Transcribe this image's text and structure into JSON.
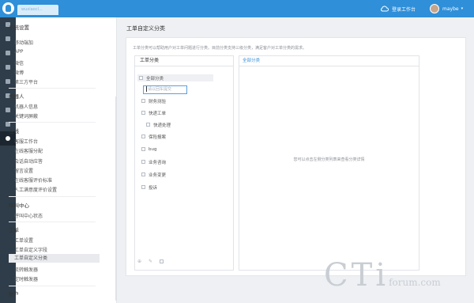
{
  "topbar": {
    "tab_label": "wuxiaocl...",
    "workbench_label": "登录工作台",
    "user_name": "maybe"
  },
  "rail_icons": [
    "home-icon",
    "chat-icon",
    "ticket-icon",
    "document-icon",
    "user-icon",
    "group-icon",
    "stats-icon",
    "search-icon",
    "settings-icon"
  ],
  "sidebar": {
    "sections": [
      {
        "title": "系统设置",
        "items": [
          "移动端加",
          "APP",
          "微信",
          "微博",
          "第三方平台"
        ]
      },
      {
        "title": "机器人",
        "items": [
          "机器人信息",
          "关键词屏蔽"
        ]
      },
      {
        "title": "在线",
        "items": [
          "客服工作台",
          "在线客服分配",
          "会话自动应答",
          "留言设置",
          "在线客服评价标准",
          "人工满意度评价设置"
        ]
      },
      {
        "title": "呼叫中心",
        "items": [
          "呼叫中心状态"
        ]
      },
      {
        "title": "工单",
        "items": [
          "工单设置",
          "工单自定义字段",
          "工单自定义分类",
          "流转触发器",
          "定时触发器"
        ]
      },
      {
        "title": "账户",
        "items": []
      }
    ]
  },
  "main": {
    "page_title": "工单自定义分类",
    "description": "工单分类可以帮助用户对工单问题进行分类。目前分类支持三级分类，满足客户对工单分类的需求。",
    "tree_header": "工单分类",
    "tree": {
      "root": "全部分类",
      "input_placeholder": "请以回车提交",
      "nodes": [
        {
          "label": "财务测验",
          "level": 1
        },
        {
          "label": "快递工单",
          "level": 1
        },
        {
          "label": "快递处理",
          "level": 2
        },
        {
          "label": "保险报案",
          "level": 1
        },
        {
          "label": "bug",
          "level": 1
        },
        {
          "label": "业务咨询",
          "level": 1
        },
        {
          "label": "业务变更",
          "level": 1
        },
        {
          "label": "投诉",
          "level": 1
        }
      ]
    },
    "detail_tab": "全部分类",
    "empty_hint": "您可以点击左侧分类列表来查看分类详情"
  },
  "watermark": {
    "main": "CTi",
    "sub": "forum.com"
  }
}
